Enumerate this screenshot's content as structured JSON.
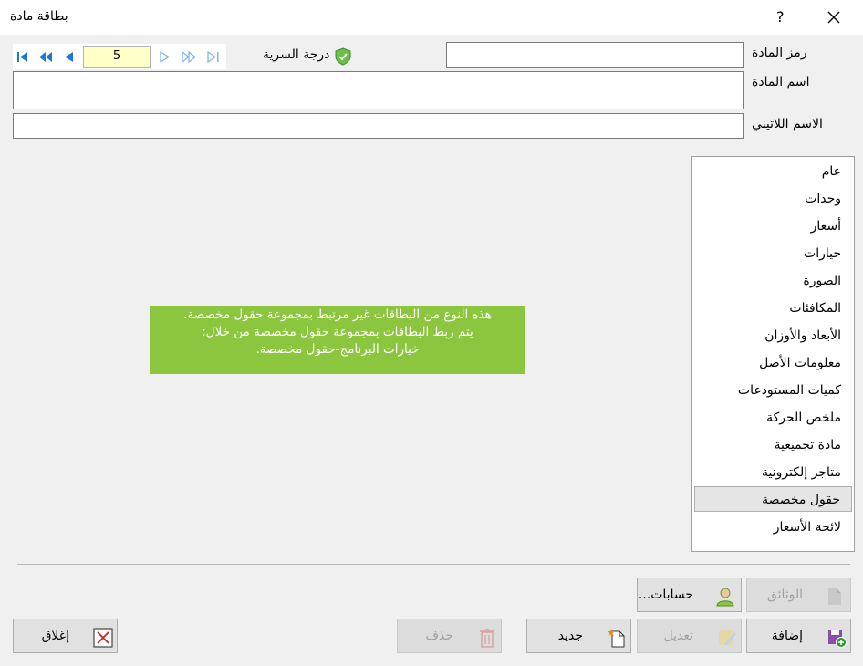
{
  "window": {
    "title": "بطاقة مادة",
    "help": "?"
  },
  "fields": {
    "code_label": "رمز المادة",
    "name_label": "اسم المادة",
    "latin_label": "الاسم اللاتيني",
    "code_value": "",
    "name_value": "",
    "latin_value": ""
  },
  "navigator": {
    "current": "5"
  },
  "security": {
    "label": "درجة السرية"
  },
  "sidebar": {
    "items": [
      {
        "label": "عام"
      },
      {
        "label": "وحدات"
      },
      {
        "label": "أسعار"
      },
      {
        "label": "خيارات"
      },
      {
        "label": "الصورة"
      },
      {
        "label": "المكافئات"
      },
      {
        "label": "الأبعاد والأوزان"
      },
      {
        "label": "معلومات الأصل"
      },
      {
        "label": "كميات المستودعات"
      },
      {
        "label": "ملخص الحركة"
      },
      {
        "label": "مادة تجميعية"
      },
      {
        "label": "متاجر إلكترونية"
      },
      {
        "label": "حقول مخصصة"
      },
      {
        "label": "لائحة الأسعار"
      }
    ],
    "selected_index": 12
  },
  "notice": {
    "line1": "هذه النوع من البطاقات غير مرتبط بمجموعة حقول مخصصة.",
    "line2": "يتم ربط البطاقات بمجموعة حقول مخصصة من خلال:",
    "line3": "خيارات البرنامج-حقول مخصصة."
  },
  "buttons": {
    "documents": "الوثائق",
    "accounts": "حسابات...",
    "add": "إضافة",
    "edit": "تعديل",
    "new": "جديد",
    "delete": "حذف",
    "close": "إغلاق"
  },
  "colors": {
    "notice_bg": "#8cc63f",
    "counter_bg": "#ffffc8",
    "nav_blue": "#1e78d2"
  }
}
